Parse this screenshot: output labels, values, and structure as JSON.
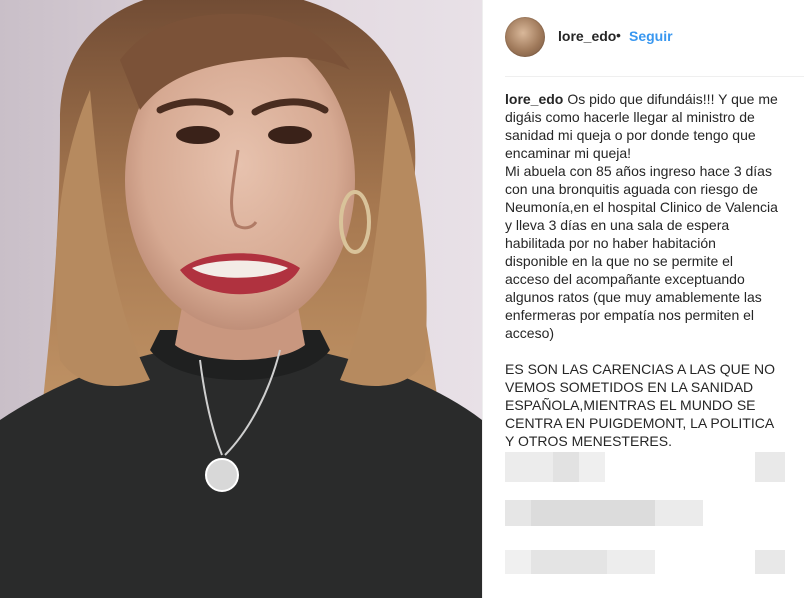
{
  "post": {
    "username": "lore_edo",
    "separator": "•",
    "follow_label": "Seguir"
  },
  "caption": {
    "username": "lore_edo",
    "paragraph_1": "Os pido que difundáis!!! Y que me digáis como hacerle llegar al ministro de sanidad mi queja o por donde tengo que encaminar mi queja!",
    "paragraph_2": "Mi abuela con 85 años ingreso hace 3 días con una bronquitis aguada con riesgo de Neumonía,en el hospital Clinico de Valencia y lleva 3 días en una sala de espera habilitada por no haber habitación disponible en la que no se permite el acceso del acompañante exceptuando algunos ratos (que muy amablemente las enfermeras por empatía nos permiten el acceso)",
    "paragraph_3": "ES SON LAS CARENCIAS A LAS QUE NO VEMOS SOMETIDOS EN LA SANIDAD ESPAÑOLA,MIENTRAS EL MUNDO SE CENTRA EN PUIGDEMONT, LA POLITICA Y OTROS MENESTERES."
  },
  "colors": {
    "link": "#3897f0",
    "text": "#262626",
    "divider": "#efefef"
  }
}
